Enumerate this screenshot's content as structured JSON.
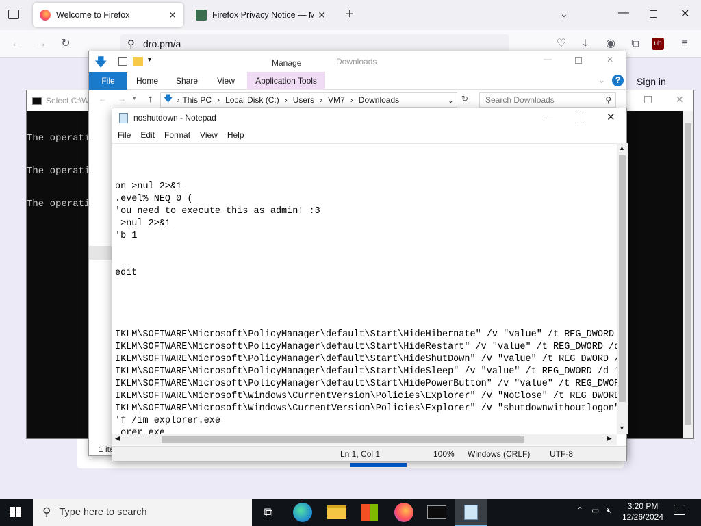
{
  "firefox": {
    "tabs": [
      {
        "title": "Welcome to Firefox",
        "active": true
      },
      {
        "title": "Firefox Privacy Notice — Mozill",
        "active": false
      }
    ],
    "url": "dro.pm/a",
    "sign_in": "Sign in"
  },
  "cmd": {
    "title": "Select C:\\W",
    "lines": [
      "The operatio",
      "The operatio",
      "The operatio"
    ]
  },
  "explorer": {
    "title": "Downloads",
    "manage_label": "Manage",
    "ribbon_tabs": [
      "File",
      "Home",
      "Share",
      "View",
      "Application Tools"
    ],
    "breadcrumb": [
      "This PC",
      "Local Disk (C:)",
      "Users",
      "VM7",
      "Downloads"
    ],
    "search_placeholder": "Search Downloads",
    "status": "1 ite"
  },
  "notepad": {
    "title": "noshutdown - Notepad",
    "menu": [
      "File",
      "Edit",
      "Format",
      "View",
      "Help"
    ],
    "lines": [
      "",
      "",
      "",
      "on >nul 2>&1",
      ".evel% NEQ 0 (",
      "'ou need to execute this as admin! :3",
      " >nul 2>&1",
      "'b 1",
      "",
      "",
      "edit",
      "",
      "",
      "",
      "",
      "IKLM\\SOFTWARE\\Microsoft\\PolicyManager\\default\\Start\\HideHibernate\" /v \"value\" /t REG_DWORD /",
      "IKLM\\SOFTWARE\\Microsoft\\PolicyManager\\default\\Start\\HideRestart\" /v \"value\" /t REG_DWORD /d",
      "IKLM\\SOFTWARE\\Microsoft\\PolicyManager\\default\\Start\\HideShutDown\" /v \"value\" /t REG_DWORD /d",
      "IKLM\\SOFTWARE\\Microsoft\\PolicyManager\\default\\Start\\HideSleep\" /v \"value\" /t REG_DWORD /d 1",
      "IKLM\\SOFTWARE\\Microsoft\\PolicyManager\\default\\Start\\HidePowerButton\" /v \"value\" /t REG_DWORD",
      "IKLM\\SOFTWARE\\Microsoft\\Windows\\CurrentVersion\\Policies\\Explorer\" /v \"NoClose\" /t REG_DWORD",
      "IKLM\\SOFTWARE\\Microsoft\\Windows\\CurrentVersion\\Policies\\Explorer\" /v \"shutdownwithoutlogon\"",
      "'f /im explorer.exe",
      ".orer.exe"
    ],
    "status": {
      "position": "Ln 1, Col 1",
      "zoom": "100%",
      "line_ending": "Windows (CRLF)",
      "encoding": "UTF-8"
    }
  },
  "taskbar": {
    "search_placeholder": "Type here to search",
    "time": "3:20 PM",
    "date": "12/26/2024"
  },
  "colors": {
    "firefox_tabbar": "#f0f0f4",
    "explorer_file_tab": "#1979ca",
    "manage_tab": "#f1dcf5",
    "taskbar": "#101419"
  }
}
